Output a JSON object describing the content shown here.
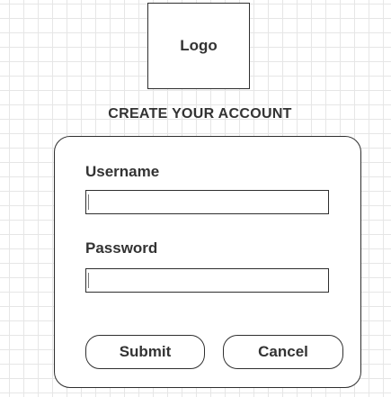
{
  "logo": {
    "label": "Logo"
  },
  "header": {
    "title": "CREATE YOUR ACCOUNT"
  },
  "form": {
    "username": {
      "label": "Username",
      "value": "",
      "placeholder": ""
    },
    "password": {
      "label": "Password",
      "value": "",
      "placeholder": ""
    },
    "submit_label": "Submit",
    "cancel_label": "Cancel"
  }
}
